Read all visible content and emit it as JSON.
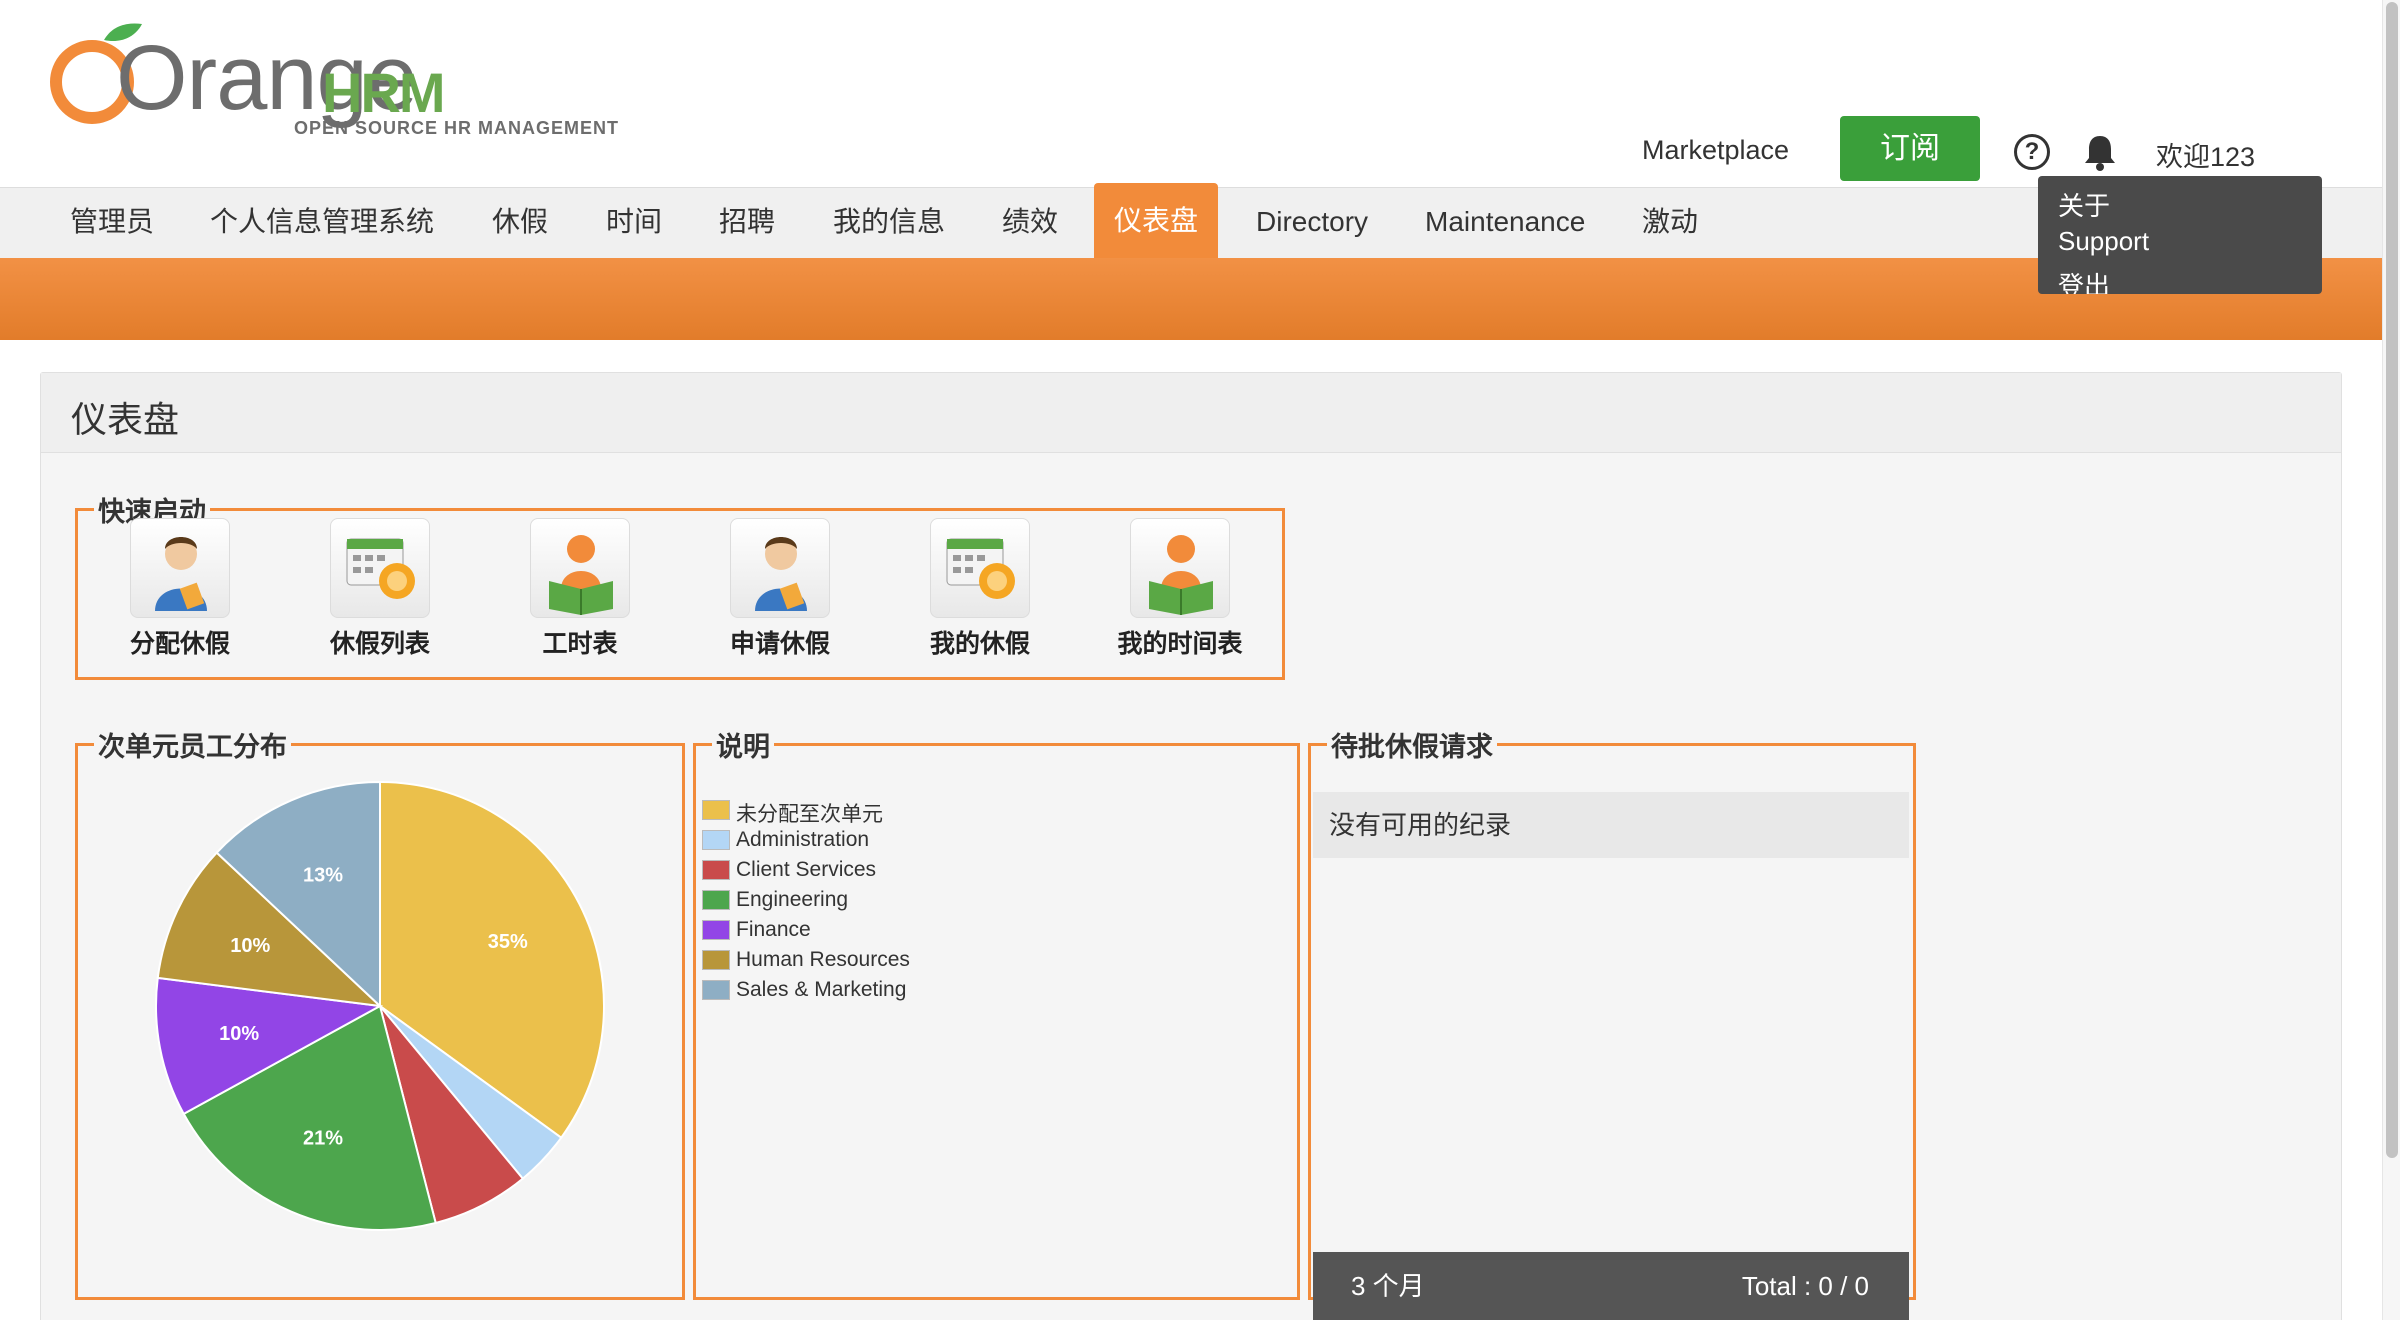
{
  "brand": {
    "logo_main": "Orange",
    "logo_hrm": "HRM",
    "logo_tagline": "OPEN SOURCE HR MANAGEMENT",
    "orange_color": "#f28b3a",
    "leaf_color": "#4caf50"
  },
  "header": {
    "marketplace": "Marketplace",
    "subscribe": "订阅",
    "help_icon": "help-icon",
    "bell_icon": "bell-icon",
    "welcome": "欢迎123"
  },
  "user_menu": {
    "items": [
      "关于",
      "Support",
      "登出"
    ]
  },
  "nav": {
    "items": [
      "管理员",
      "个人信息管理系统",
      "休假",
      "时间",
      "招聘",
      "我的信息",
      "绩效",
      "仪表盘",
      "Directory",
      "Maintenance",
      "激动"
    ],
    "active": "仪表盘"
  },
  "page": {
    "title": "仪表盘"
  },
  "quick_launch": {
    "title": "快速启动",
    "items": [
      {
        "label": "分配休假",
        "icon": "assign-leave-icon"
      },
      {
        "label": "休假列表",
        "icon": "leave-list-icon"
      },
      {
        "label": "工时表",
        "icon": "timesheet-icon"
      },
      {
        "label": "申请休假",
        "icon": "apply-leave-icon"
      },
      {
        "label": "我的休假",
        "icon": "my-leave-icon"
      },
      {
        "label": "我的时间表",
        "icon": "my-timesheet-icon"
      }
    ]
  },
  "distribution": {
    "title": "次单元员工分布"
  },
  "legend": {
    "title": "说明"
  },
  "pending": {
    "title": "待批休假请求",
    "empty": "没有可用的纪录",
    "period": "3 个月",
    "total": "Total : 0 / 0"
  },
  "chart_data": {
    "type": "pie",
    "title": "",
    "series": [
      {
        "name": "未分配至次单元",
        "value": 35,
        "label": "35%",
        "color": "#ebc04b"
      },
      {
        "name": "Administration",
        "value": 4,
        "label": "",
        "color": "#b3d6f5"
      },
      {
        "name": "Client Services",
        "value": 7,
        "label": "",
        "color": "#c94b4b"
      },
      {
        "name": "Engineering",
        "value": 21,
        "label": "21%",
        "color": "#4da64d"
      },
      {
        "name": "Finance",
        "value": 10,
        "label": "10%",
        "color": "#9245e6"
      },
      {
        "name": "Human Resources",
        "value": 10,
        "label": "10%",
        "color": "#b8963a"
      },
      {
        "name": "Sales & Marketing",
        "value": 13,
        "label": "13%",
        "color": "#8eaec4"
      }
    ]
  }
}
